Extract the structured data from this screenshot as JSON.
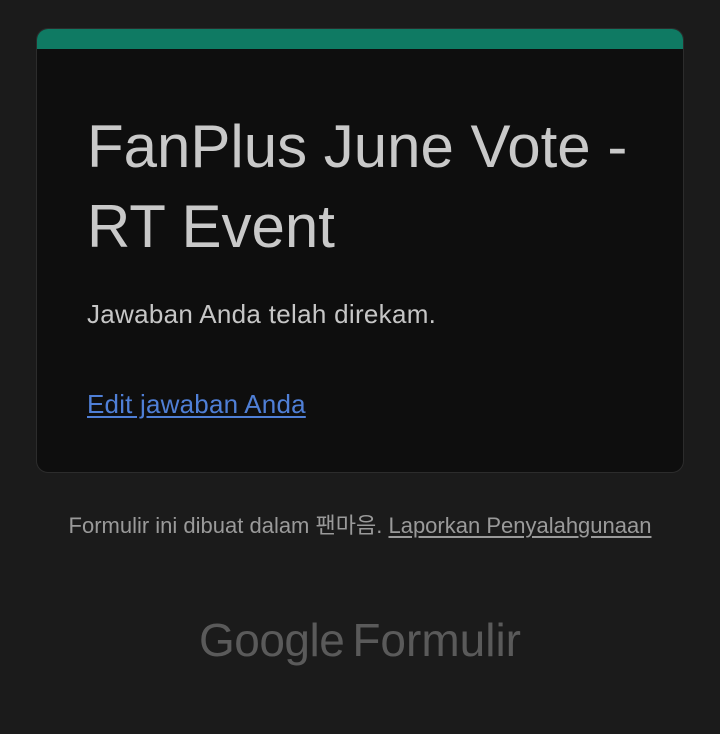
{
  "form": {
    "title": "FanPlus June Vote - RT Event",
    "confirmation_message": "Jawaban Anda telah direkam.",
    "edit_link_label": "Edit jawaban Anda"
  },
  "footer": {
    "created_in_text": "Formulir ini dibuat dalam 팬마음.",
    "report_abuse_label": "Laporkan Penyalahgunaan"
  },
  "brand": {
    "google": "Google",
    "product": "Formulir"
  },
  "colors": {
    "background": "#1b1b1b",
    "card_background": "#0e0e0e",
    "accent": "#0f7a63",
    "link": "#4f7fd6"
  }
}
